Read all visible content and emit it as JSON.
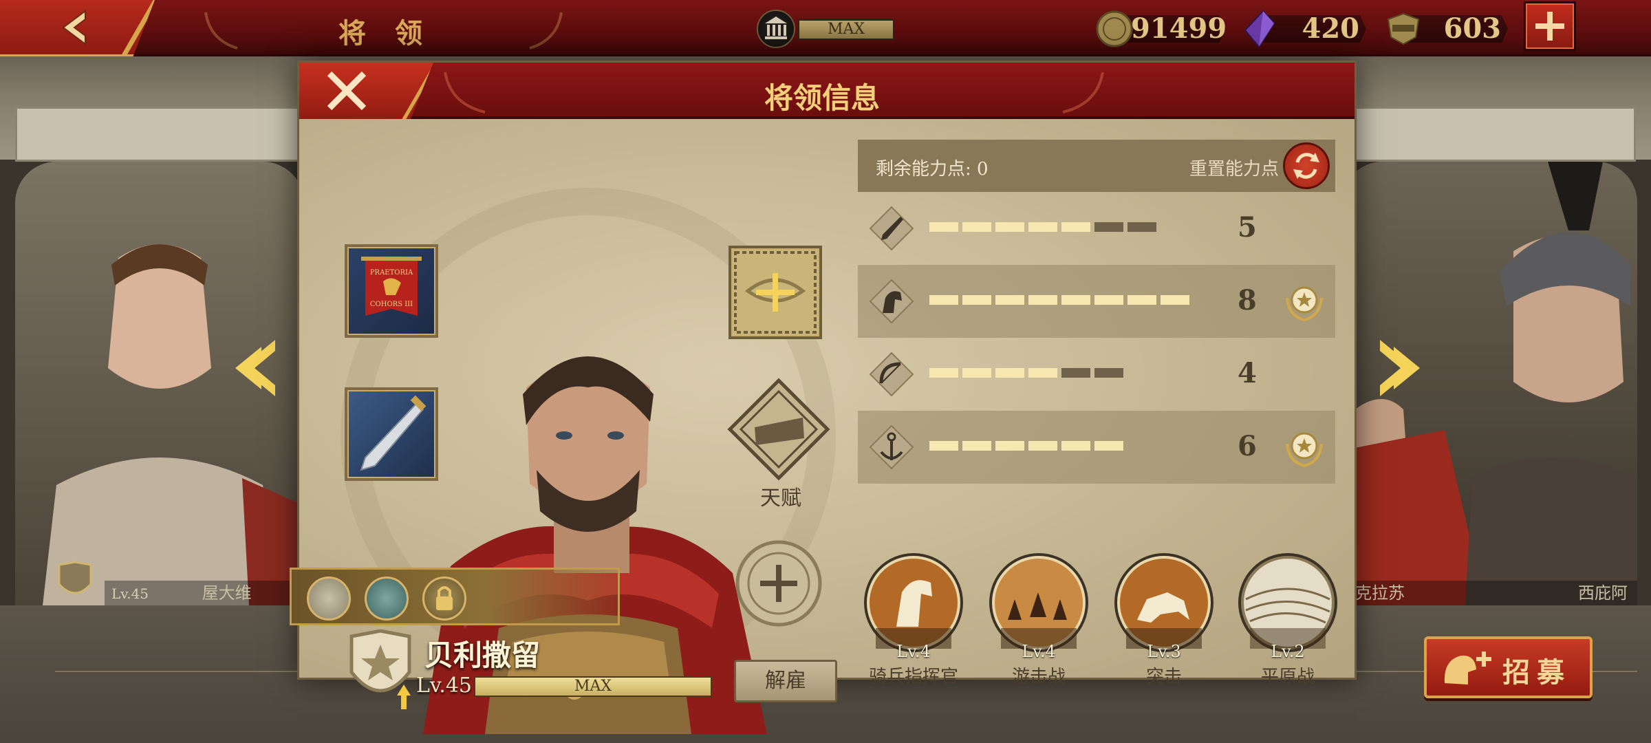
{
  "topbar": {
    "title": "将 领",
    "storage": {
      "label": "MAX",
      "icon": "treasury-icon"
    },
    "resources": [
      {
        "name": "coins",
        "icon": "coin-icon",
        "value": "91499"
      },
      {
        "name": "gems",
        "icon": "gem-icon",
        "value": "420"
      },
      {
        "name": "spqr",
        "icon": "spqr-icon",
        "value": "603"
      }
    ]
  },
  "background": {
    "left_card": {
      "name": "屋大维",
      "level": "Lv.45"
    },
    "right_card": {
      "name": "西庇阿",
      "partial_name": "克拉苏"
    }
  },
  "recruit": {
    "label": "招募"
  },
  "modal": {
    "title": "将领信息",
    "talent_label": "天赋",
    "general": {
      "name": "贝利撒留",
      "level": "Lv.45",
      "level_bar": "MAX",
      "dismiss": "解雇"
    },
    "points": {
      "label": "剩余能力点:",
      "value": "0",
      "reset_label": "重置能力点"
    },
    "stats": [
      {
        "name": "infantry",
        "icon": "sword-icon",
        "value": "5",
        "max": 7,
        "filled": 5,
        "badge": false
      },
      {
        "name": "cavalry",
        "icon": "horse-icon",
        "value": "8",
        "max": 8,
        "filled": 8,
        "badge": true
      },
      {
        "name": "archer",
        "icon": "bow-icon",
        "value": "4",
        "max": 6,
        "filled": 4,
        "badge": false
      },
      {
        "name": "navy",
        "icon": "anchor-icon",
        "value": "6",
        "max": 6,
        "filled": 6,
        "badge": true
      }
    ],
    "skills": [
      {
        "level": "Lv.4",
        "name": "骑兵指挥官",
        "icon": "horse-head-icon"
      },
      {
        "level": "Lv.4",
        "name": "游击战",
        "icon": "riders-icon"
      },
      {
        "level": "Lv.3",
        "name": "突击",
        "icon": "charge-icon"
      },
      {
        "level": "Lv.2",
        "name": "平原战",
        "icon": "plain-icon"
      }
    ],
    "banner_text": [
      "PRAETORIA",
      "COHORS III"
    ]
  },
  "colors": {
    "header_red": "#8e1616",
    "gold": "#f3cf7a",
    "parchment": "#c7b897",
    "bar_on": "#f6e8b0",
    "bar_off": "#6f614a"
  }
}
